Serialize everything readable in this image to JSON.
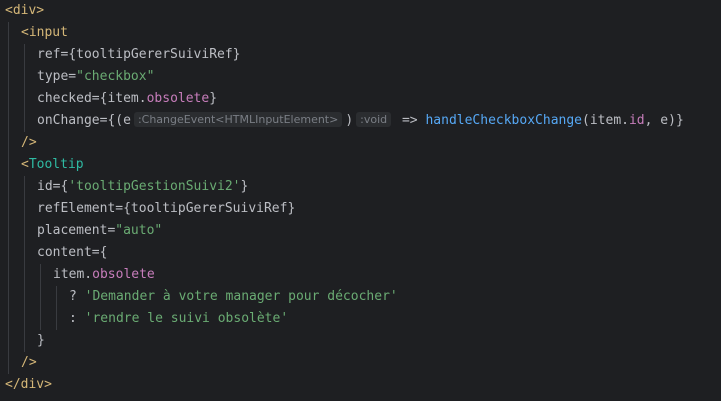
{
  "code": {
    "div_open": "<div>",
    "input_open": "<input",
    "attr_ref": "ref=",
    "ref_value": "{tooltipGererSuiviRef}",
    "attr_type": "type=",
    "type_value": "\"checkbox\"",
    "attr_checked": "checked=",
    "checked_pre": "{item.",
    "checked_prop": "obsolete",
    "checked_post": "}",
    "attr_onchange": "onChange=",
    "onchange_pre": "{(e",
    "hint_param_type": ":ChangeEvent<HTMLInputElement>",
    "paren_close": ")",
    "hint_return_type": ":void",
    "arrow": " => ",
    "handler_name": "handleCheckboxChange",
    "handler_args_pre": "(item.",
    "handler_prop_id": "id",
    "handler_args_post": ", e)}",
    "self_close_1": "/>",
    "tooltip_lt": "<",
    "tooltip_name": "Tooltip",
    "attr_id": "id=",
    "id_pre": "{",
    "id_value": "'tooltipGestionSuivi2'",
    "id_post": "}",
    "attr_refelement": "refElement=",
    "refelement_value": "{tooltipGererSuiviRef}",
    "attr_placement": "placement=",
    "placement_value": "\"auto\"",
    "attr_content": "content=",
    "content_open": "{",
    "item_pre": "item.",
    "item_prop": "obsolete",
    "ternary_q": "? ",
    "str_true": "'Demander à votre manager pour décocher'",
    "ternary_colon": ": ",
    "str_false": "'rendre le suivi obsolète'",
    "content_close": "}",
    "self_close_2": "/>",
    "div_close": "</div>"
  }
}
